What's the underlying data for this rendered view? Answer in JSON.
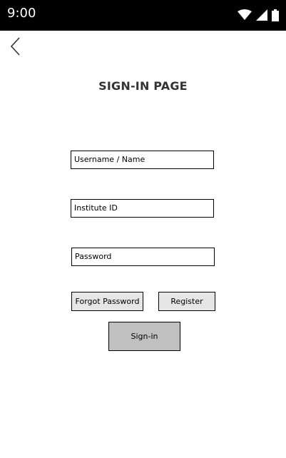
{
  "status_bar": {
    "time": "9:00",
    "icons": [
      "wifi-icon",
      "cell-signal-icon",
      "battery-icon"
    ]
  },
  "nav": {
    "back_icon": "chevron-left-icon"
  },
  "page": {
    "title": "SIGN-IN PAGE"
  },
  "form": {
    "username_placeholder": "Username / Name",
    "institute_placeholder": "Institute ID",
    "password_placeholder": "Password"
  },
  "buttons": {
    "forgot_password": "Forgot Password",
    "register": "Register",
    "sign_in": "Sign-in"
  },
  "colors": {
    "status_bar_bg": "#000000",
    "secondary_button_bg": "#e6e6e6",
    "primary_button_bg": "#c0c0c0"
  }
}
